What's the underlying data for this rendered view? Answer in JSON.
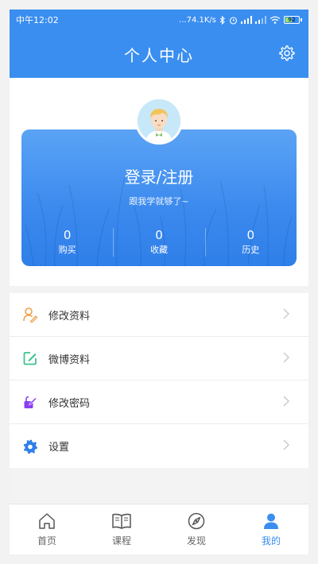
{
  "colors": {
    "primary": "#3a8ef0",
    "profile_orange": "#f0a04b",
    "weibo_green": "#3fc38e",
    "password_purple": "#8a3ff0",
    "settings_blue": "#2f7fe9"
  },
  "status_bar": {
    "time": "中午12:02",
    "network_speed": "...74.1K/s",
    "battery": "92"
  },
  "header": {
    "title": "个人中心",
    "settings_icon": "gear-icon"
  },
  "profile": {
    "login_label": "登录/注册",
    "motto": "跟我学就够了~",
    "stats": [
      {
        "value": "0",
        "label": "购买"
      },
      {
        "value": "0",
        "label": "收藏"
      },
      {
        "value": "0",
        "label": "历史"
      }
    ]
  },
  "menu": {
    "items": [
      {
        "label": "修改资料",
        "icon": "user-edit-icon"
      },
      {
        "label": "微博资料",
        "icon": "edit-square-icon"
      },
      {
        "label": "修改密码",
        "icon": "password-edit-icon"
      },
      {
        "label": "设置",
        "icon": "gear-icon"
      }
    ]
  },
  "tabbar": {
    "tabs": [
      {
        "label": "首页",
        "icon": "home-icon",
        "active": false
      },
      {
        "label": "课程",
        "icon": "book-icon",
        "active": false
      },
      {
        "label": "发现",
        "icon": "compass-icon",
        "active": false
      },
      {
        "label": "我的",
        "icon": "user-icon",
        "active": true
      }
    ]
  }
}
